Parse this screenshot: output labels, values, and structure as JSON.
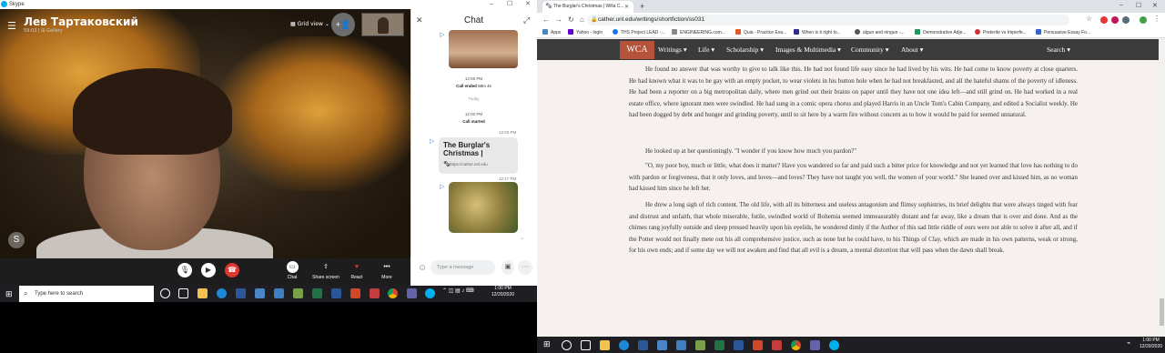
{
  "skype": {
    "window_title": "Skype",
    "caller_name": "Лев Тартаковский",
    "caller_sub": "59:03 | ⊞ Gallery",
    "grid_view": "Grid view",
    "call_bar": {
      "chat": "Chat",
      "share_screen": "Share screen",
      "react": "React",
      "more": "More"
    }
  },
  "chat": {
    "title": "Chat",
    "time1": "12:56 PM",
    "call_ended": "Call ended",
    "call_ended_dur": "58m 4s",
    "today": "Today",
    "time2": "12:00 PM",
    "call_started": "Call started",
    "link_time": "12:02 PM",
    "link_title": "The Burglar's Christmas |",
    "link_url": "https://cather.unl.edu",
    "img_time": "12:17 PM",
    "input_placeholder": "Type a message"
  },
  "taskbar_left": {
    "search_placeholder": "Type here to search",
    "time": "1:00 PM",
    "date": "12/20/2020"
  },
  "browser": {
    "tab_title": "The Burglar's Christmas | Willa C...",
    "url": "cather.unl.edu/writings/shortfiction/ss031",
    "bookmarks": [
      {
        "label": "Apps",
        "color": "#4a86c5"
      },
      {
        "label": "Yahoo - login",
        "color": "#6001d2"
      },
      {
        "label": "THS Project LEAD -...",
        "color": "#1a73e8"
      },
      {
        "label": "ENGINEERING.com...",
        "color": "#888888"
      },
      {
        "label": "Quia - Practice Exa...",
        "color": "#e05a2b"
      },
      {
        "label": "When is it right to...",
        "color": "#2b2b8a"
      },
      {
        "label": "algun and ningun -...",
        "color": "#555555"
      },
      {
        "label": "Demonstrative Adje...",
        "color": "#1a9a5a"
      },
      {
        "label": "Preterite vs Imperfe...",
        "color": "#cc3333"
      },
      {
        "label": "Persuasive Essay Fo...",
        "color": "#3366cc"
      }
    ],
    "nav": {
      "logo": "WCA",
      "items": [
        "Writings ▾",
        "Life ▾",
        "Scholarship ▾",
        "Images & Multimedia ▾",
        "Community ▾",
        "About ▾"
      ],
      "search": "Search ▾"
    },
    "paragraphs": [
      "He found no answer that was worthy to give to talk like this. He had not found life easy since he had lived by his wits. He had come to know poverty at close quarters. He had known what it was to be gay with an empty pocket, to wear violets in his button hole when he had not breakfasted, and all the hateful shams of the poverty of idleness. He had been a reporter on a big metropolitan daily, where men grind out their brains on paper until they have not one idea left—and still grind on. He had worked in a real estate office, where ignorant men were swindled. He had sung in a comic opera chorus and played Harris in an Uncle Tom's Cabin Company, and edited a Socialist weekly. He had been dogged by debt and hunger and grinding poverty, until to sit here by a warm fire without concern as to how it would be paid for seemed unnatural.",
      "He looked up at her questioningly. \"I wonder if you know how much you pardon?\"",
      "\"O, my poor boy, much or little, what does it matter? Have you wandered so far and paid such a bitter price for knowledge and not yet learned that love has nothing to do with pardon or forgiveness, that it only loves, and loves—and loves? They have not taught you well, the women of your world.\" She leaned over and kissed him, as no woman had kissed him since he left her.",
      "He drew a long sigh of rich content. The old life, with all its bitterness and useless antagonism and flimsy sophistries, its brief delights that were always tinged with fear and distrust and unfaith, that whole miserable, futile, swindled world of Bohemia seemed immeasurably distant and far away, like a dream that is over and done. And as the chimes rang joyfully outside and sleep pressed heavily upon his eyelids, he wondered dimly if the Author of this sad little riddle of ours were not able to solve it after all, and if the Potter would not finally mete out his all comprehensive justice, such as none but he could have, to his Things of Clay, which are made in his own patterns, weak or strong, for his own ends; and if some day we will not awaken and find that all evil is a dream, a mental distortion that will pass when the dawn shall break."
    ]
  },
  "taskbar_right": {
    "time": "1:00 PM",
    "date": "12/20/2020"
  }
}
